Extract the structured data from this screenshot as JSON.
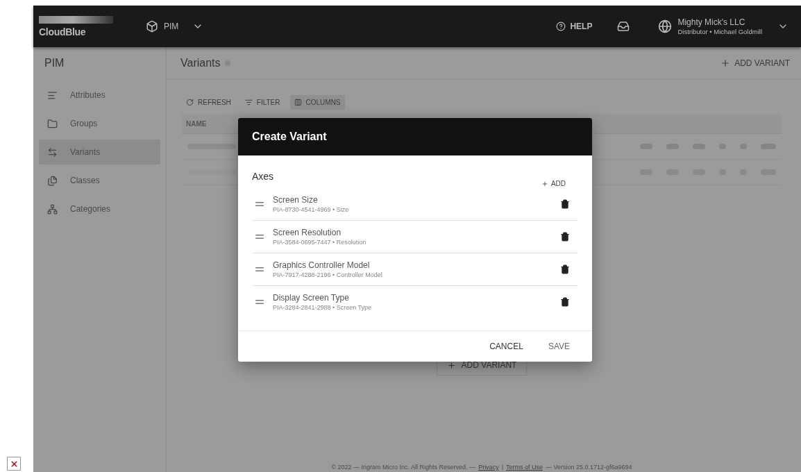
{
  "topbar": {
    "logo": "CloudBlue",
    "module": "PIM",
    "help": "HELP",
    "account": {
      "name": "Mighty Mick's LLC",
      "detail": "Distributor • Michael Goldmill"
    }
  },
  "sidebar": {
    "title": "PIM",
    "items": [
      {
        "label": "Attributes",
        "selected": false
      },
      {
        "label": "Groups",
        "selected": false
      },
      {
        "label": "Variants",
        "selected": true
      },
      {
        "label": "Classes",
        "selected": false
      },
      {
        "label": "Categories",
        "selected": false
      }
    ]
  },
  "page": {
    "title": "Variants",
    "action": "ADD VARIANT"
  },
  "toolbar": [
    {
      "label": "REFRESH",
      "selected": false
    },
    {
      "label": "FILTER",
      "selected": false
    },
    {
      "label": "COLUMNS",
      "selected": true
    }
  ],
  "table": {
    "columns": [
      "NAME"
    ],
    "empty_action": "ADD VARIANT"
  },
  "footer": {
    "copyright": "© 2022 — Ingram Micro Inc. All Rights Reserved. —",
    "links": [
      "Privacy",
      "Terms of Use"
    ],
    "separator": "|",
    "version": "— Version 25.0.1712-gf6a9694"
  },
  "dialog": {
    "title": "Create Variant",
    "section": "Axes",
    "add": "ADD",
    "axes": [
      {
        "name": "Screen Size",
        "detail": "PIA-8730-4541-4969 • Size"
      },
      {
        "name": "Screen Resolution",
        "detail": "PIA-3584-0695-7447 • Resolution"
      },
      {
        "name": "Graphics Controller Model",
        "detail": "PIA-7917-4288-2196 • Controller Model"
      },
      {
        "name": "Display Screen Type",
        "detail": "PIA-3284-2841-2988 • Screen Type"
      }
    ],
    "buttons": [
      "CANCEL",
      "SAVE"
    ]
  }
}
